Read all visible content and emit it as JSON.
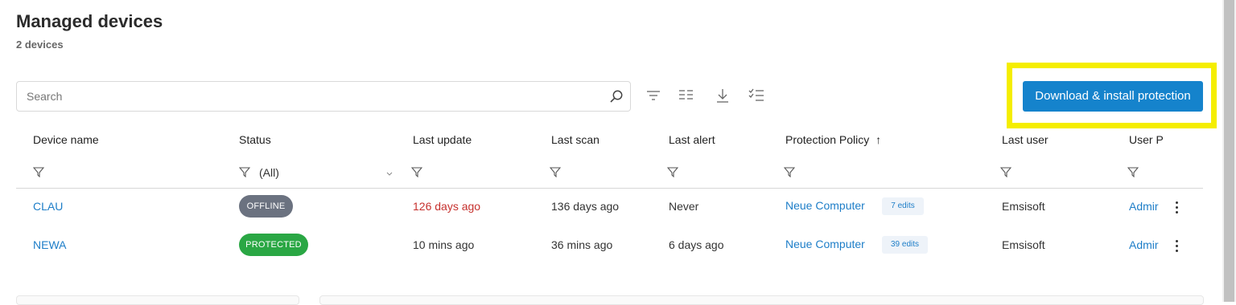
{
  "header": {
    "title": "Managed devices",
    "subtitle": "2 devices"
  },
  "search": {
    "placeholder": "Search",
    "value": ""
  },
  "toolbar": {
    "icons": [
      "search-icon",
      "sort-icon",
      "columns-icon",
      "download-icon",
      "checklist-icon"
    ],
    "download_protection_label": "Download & install protection",
    "highlight_color": "#f5ee00",
    "accent": "#1583cc"
  },
  "table": {
    "columns": [
      "Device name",
      "Status",
      "Last update",
      "Last scan",
      "Last alert",
      "Protection Policy",
      "Last user",
      "User P"
    ],
    "sort_indicator": "↑",
    "status_filter": "(All)",
    "rows": [
      {
        "device": "CLAU",
        "status": "OFFLINE",
        "last_update": "126 days ago",
        "last_scan": "136 days ago",
        "last_alert": "Never",
        "policy": "Neue Computer",
        "edits": "7 edits",
        "last_user": "Emsisoft",
        "user_p": "Admir"
      },
      {
        "device": "NEWA",
        "status": "PROTECTED",
        "last_update": "10 mins ago",
        "last_scan": "36 mins ago",
        "last_alert": "6 days ago",
        "policy": "Neue Computer",
        "edits": "39 edits",
        "last_user": "Emsisoft",
        "user_p": "Admir"
      }
    ],
    "status_colors": {
      "OFFLINE": "#6b7280",
      "PROTECTED": "#2aa744"
    },
    "stale_color": "#c6312e"
  }
}
